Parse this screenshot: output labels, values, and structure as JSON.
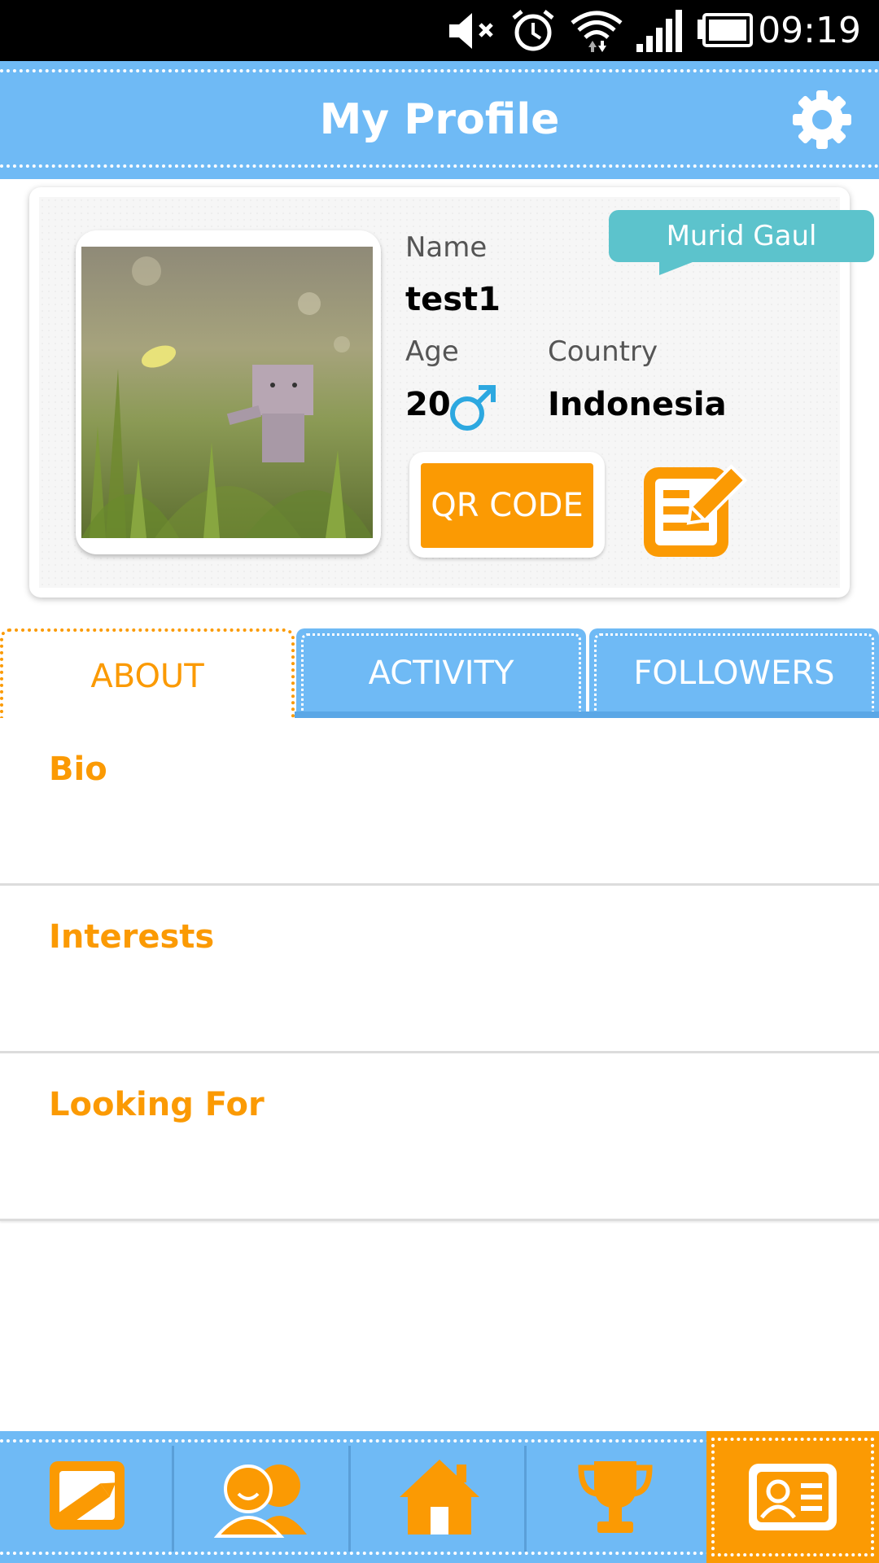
{
  "status_bar": {
    "time": "09:19",
    "icons": [
      "mute-icon",
      "alarm-icon",
      "wifi-icon",
      "signal-icon",
      "battery-icon"
    ]
  },
  "header": {
    "title": "My Profile",
    "settings_icon": "gear-icon"
  },
  "profile": {
    "badge": "Murid Gaul",
    "name_label": "Name",
    "name": "test1",
    "age_label": "Age",
    "age": "20",
    "gender_icon": "male-symbol-icon",
    "country_label": "Country",
    "country": "Indonesia",
    "qr_button": "QR CODE",
    "edit_icon": "edit-profile-icon"
  },
  "tabs": [
    {
      "label": "ABOUT",
      "active": true
    },
    {
      "label": "ACTIVITY",
      "active": false
    },
    {
      "label": "FOLLOWERS",
      "active": false
    }
  ],
  "sections": [
    {
      "title": "Bio"
    },
    {
      "title": "Interests"
    },
    {
      "title": "Looking For"
    }
  ],
  "bottom_nav": [
    {
      "icon": "note-pencil-icon",
      "active": false
    },
    {
      "icon": "friends-icon",
      "active": false
    },
    {
      "icon": "home-icon",
      "active": false
    },
    {
      "icon": "trophy-icon",
      "active": false
    },
    {
      "icon": "profile-card-icon",
      "active": true
    }
  ],
  "colors": {
    "accent": "#fb9a03",
    "header_blue": "#6fbaf5",
    "badge_teal": "#5cc3cc"
  }
}
